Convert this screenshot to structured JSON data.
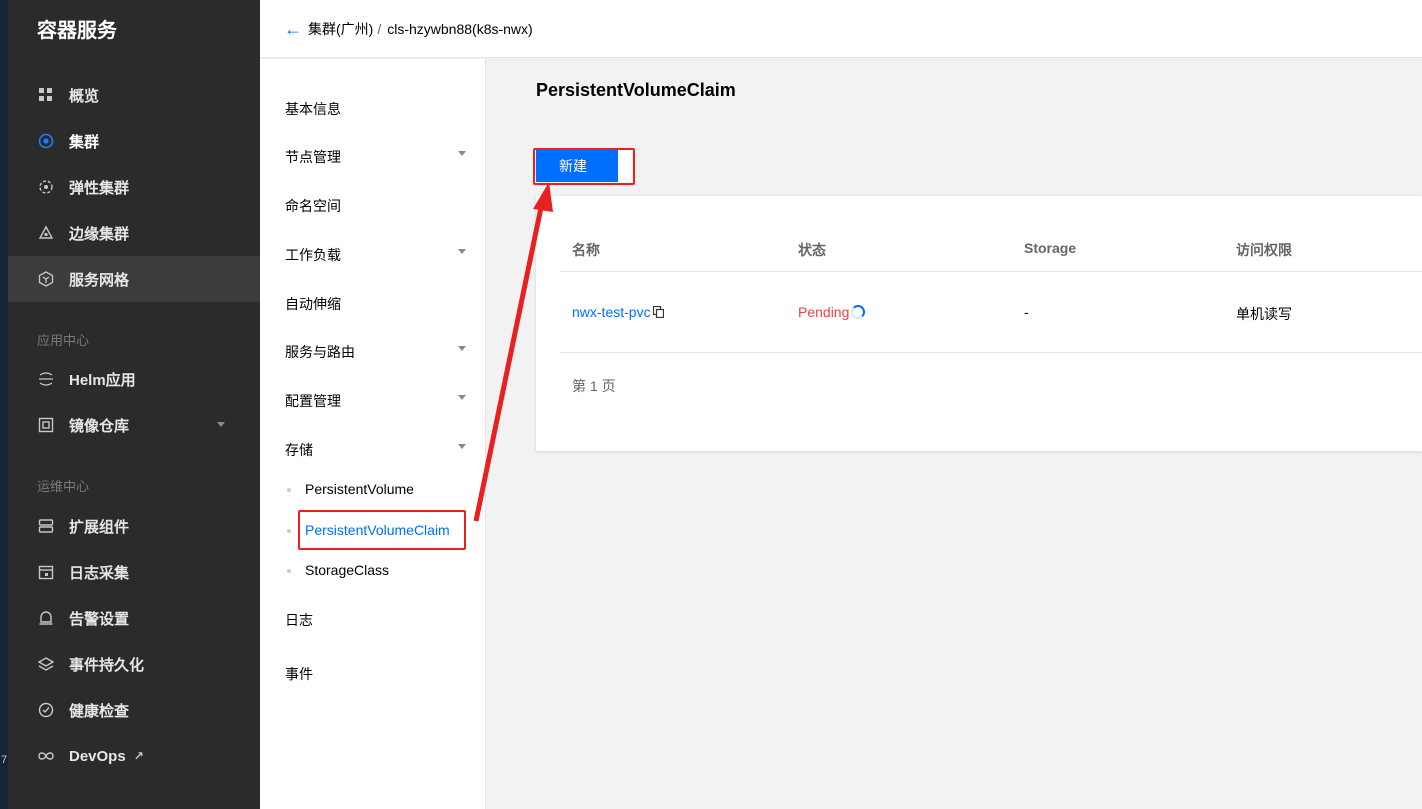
{
  "sidebar": {
    "brand": "容器服务",
    "items_top": [
      {
        "label": "概览",
        "icon": "grid-icon"
      },
      {
        "label": "集群",
        "icon": "cluster-icon",
        "selected": true
      },
      {
        "label": "弹性集群",
        "icon": "elastic-icon"
      },
      {
        "label": "边缘集群",
        "icon": "edge-icon"
      },
      {
        "label": "服务网格",
        "icon": "mesh-icon"
      }
    ],
    "section_app": "应用中心",
    "items_app": [
      {
        "label": "Helm应用",
        "icon": "helm-icon"
      },
      {
        "label": "镜像仓库",
        "icon": "registry-icon"
      }
    ],
    "section_ops": "运维中心",
    "items_ops": [
      {
        "label": "扩展组件",
        "icon": "addon-icon"
      },
      {
        "label": "日志采集",
        "icon": "calendar-icon"
      },
      {
        "label": "告警设置",
        "icon": "alarm-icon"
      },
      {
        "label": "事件持久化",
        "icon": "layers-icon"
      },
      {
        "label": "健康检查",
        "icon": "health-icon"
      },
      {
        "label": "DevOps",
        "icon": "infinity-icon"
      }
    ],
    "edge_digit": "7"
  },
  "breadcrumb": {
    "parent": "集群(广州)",
    "separator": "/",
    "current": "cls-hzywbn88(k8s-nwx)"
  },
  "submenu": {
    "items": [
      "基本信息",
      "节点管理",
      "命名空间",
      "工作负载",
      "自动伸缩",
      "服务与路由",
      "配置管理",
      "存储"
    ],
    "storage_children": [
      "PersistentVolume",
      "PersistentVolumeClaim",
      "StorageClass"
    ],
    "bottom_items": [
      "日志",
      "事件"
    ]
  },
  "main": {
    "title": "PersistentVolumeClaim",
    "new_button": "新建",
    "table": {
      "columns": [
        "名称",
        "状态",
        "Storage",
        "访问权限"
      ],
      "rows": [
        {
          "name": "nwx-test-pvc",
          "status": "Pending",
          "storage": "-",
          "access": "单机读写"
        }
      ]
    },
    "pager": "第 1 页"
  },
  "colors": {
    "accent": "#006eff",
    "sidebar_bg": "#2b2b2b",
    "highlight": "#e8201f",
    "pending": "#e54545"
  }
}
